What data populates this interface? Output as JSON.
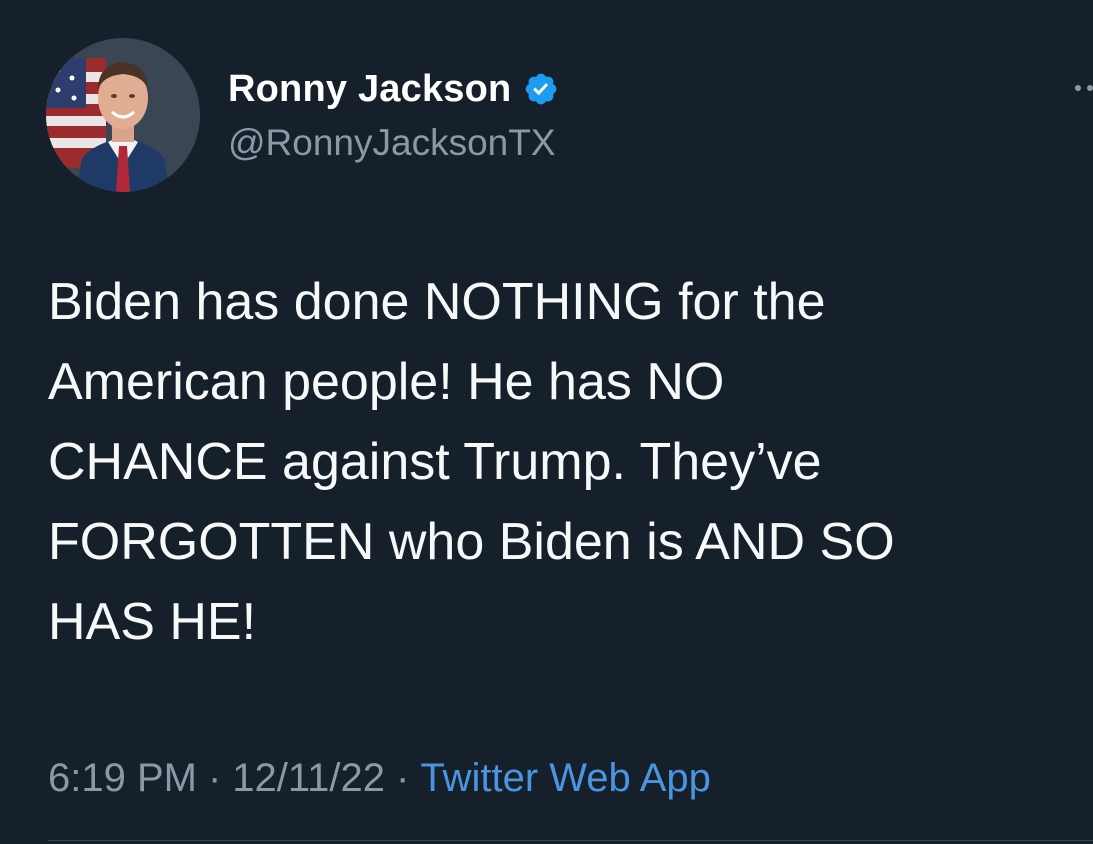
{
  "author": {
    "display_name": "Ronny Jackson",
    "handle": "@RonnyJacksonTX",
    "verified": true,
    "verified_icon": "verified-badge-icon",
    "avatar_icon": "profile-photo"
  },
  "tweet": {
    "lines": [
      "Biden has done NOTHING for the",
      "American people! He has NO",
      "CHANCE against Trump. They’ve",
      "FORGOTTEN who Biden is AND SO",
      "HAS HE!"
    ]
  },
  "meta": {
    "time": "6:19 PM",
    "separator": "·",
    "date": "12/11/22",
    "source": "Twitter Web App"
  },
  "colors": {
    "background": "#15202b",
    "text_primary": "#f7f9f9",
    "text_secondary": "#8b98a5",
    "link": "#4a94e0",
    "verified": "#1d9bf0",
    "divider": "#38444d"
  },
  "icons": {
    "more": "more-options-icon"
  }
}
